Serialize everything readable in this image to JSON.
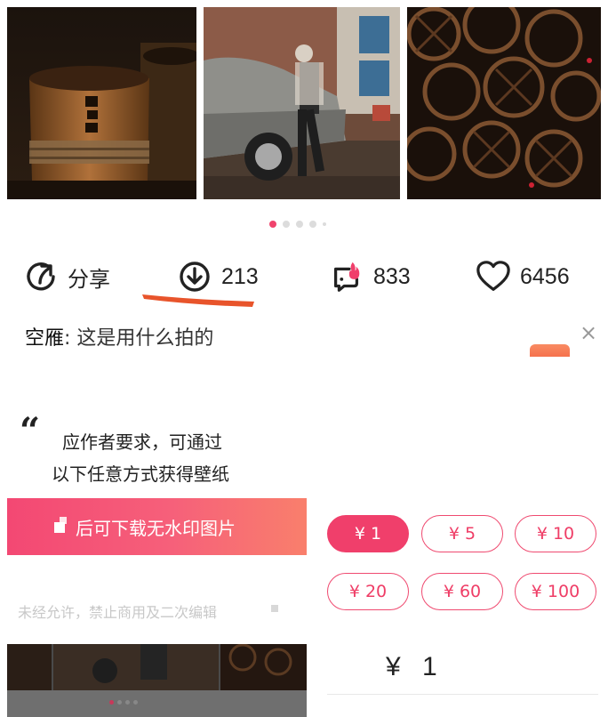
{
  "carousel": {
    "page_count": 5,
    "active_index": 0
  },
  "actions": {
    "share_label": "分享",
    "download_count": "213",
    "hot_count": "833",
    "like_count": "6456"
  },
  "comment": {
    "user": "空雁",
    "separator": ": ",
    "text": "这是用什么拍的"
  },
  "close_symbol": "×",
  "quote_mark": "“",
  "prompt": {
    "line1": "应作者要求，可通过",
    "line2": "以下任意方式获得壁纸"
  },
  "download_banner": {
    "label": "后可下载无水印图片"
  },
  "notice": "未经允许，禁止商用及二次编辑",
  "amounts": [
    "¥ 1",
    "¥ 5",
    "¥ 10",
    "¥ 20",
    "¥ 60",
    "¥ 100"
  ],
  "selected_amount_index": 0,
  "amount_display": "¥ 1",
  "colors": {
    "accent": "#f03f6b",
    "banner_start": "#f34873",
    "banner_end": "#f97f6c",
    "underline": "#e8542b"
  },
  "icons": [
    "share-icon",
    "download-icon",
    "hot-chat-icon",
    "heart-icon",
    "close-icon"
  ]
}
